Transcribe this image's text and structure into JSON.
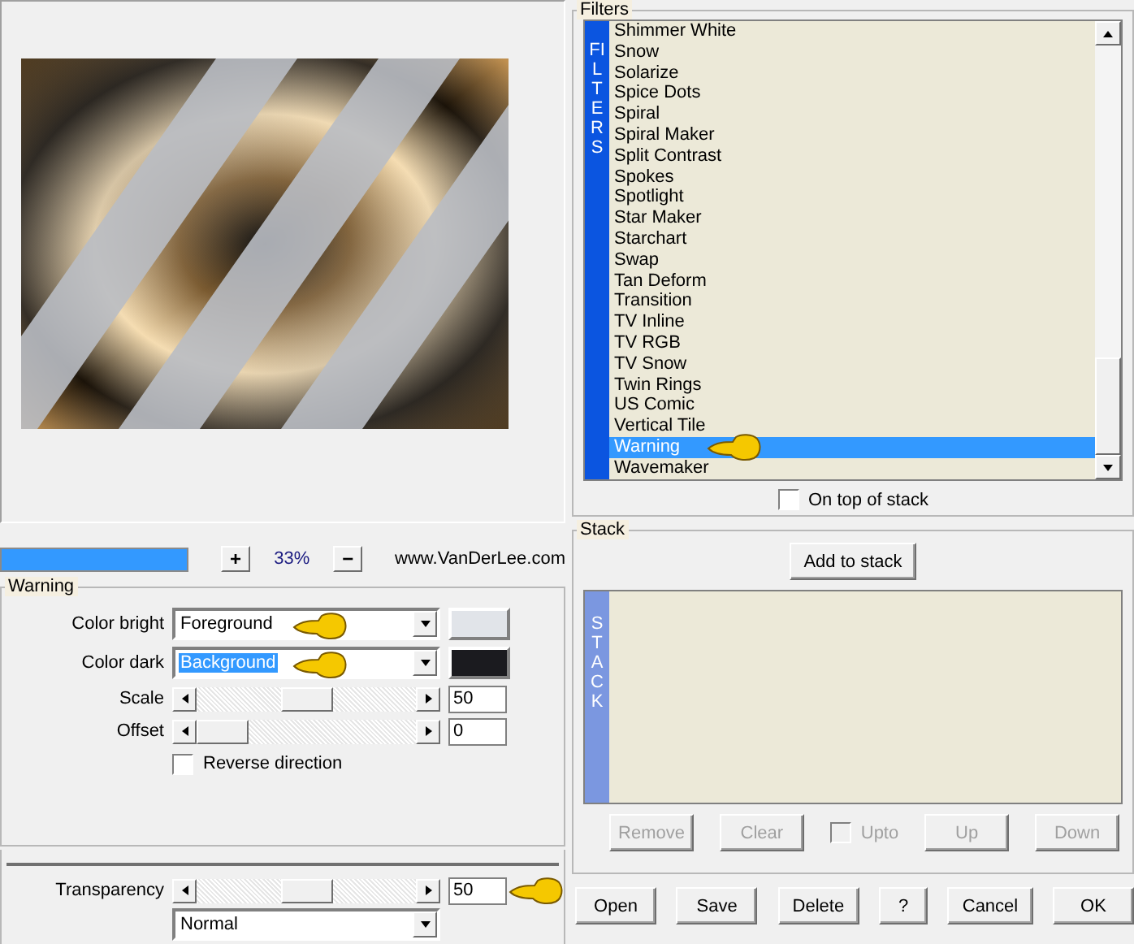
{
  "zoom": {
    "level": 1,
    "plus": "+",
    "value": "33%",
    "minus": "−",
    "link": "www.VanDerLee.com"
  },
  "effect": {
    "title": "Warning",
    "colors": [
      {
        "label": "Color bright",
        "value": "Foreground",
        "selected": false,
        "color": "#e1e4e9"
      },
      {
        "label": "Color dark",
        "value": "Background",
        "selected": true,
        "color": "#1b1b1f"
      }
    ],
    "sliders": [
      {
        "label": "Scale",
        "level": 0.5,
        "value": "50"
      },
      {
        "label": "Offset",
        "level": 0,
        "value": "0"
      }
    ],
    "reverse": {
      "label": "Reverse direction",
      "checked": false
    }
  },
  "transparency": {
    "label": "Transparency",
    "level": 0.5,
    "value": "50",
    "mode": "Normal"
  },
  "filters": {
    "title": "Filters",
    "band": "FILTERS",
    "items": [
      {
        "label": "Shimmer White",
        "selected": false
      },
      {
        "label": "Snow",
        "selected": false
      },
      {
        "label": "Solarize",
        "selected": false
      },
      {
        "label": "Spice Dots",
        "selected": false
      },
      {
        "label": "Spiral",
        "selected": false
      },
      {
        "label": "Spiral Maker",
        "selected": false
      },
      {
        "label": "Split Contrast",
        "selected": false
      },
      {
        "label": "Spokes",
        "selected": false
      },
      {
        "label": "Spotlight",
        "selected": false
      },
      {
        "label": "Star Maker",
        "selected": false
      },
      {
        "label": "Starchart",
        "selected": false
      },
      {
        "label": "Swap",
        "selected": false
      },
      {
        "label": "Tan Deform",
        "selected": false
      },
      {
        "label": "Transition",
        "selected": false
      },
      {
        "label": "TV Inline",
        "selected": false
      },
      {
        "label": "TV RGB",
        "selected": false
      },
      {
        "label": "TV Snow",
        "selected": false
      },
      {
        "label": "Twin Rings",
        "selected": false
      },
      {
        "label": "US Comic",
        "selected": false
      },
      {
        "label": "Vertical Tile",
        "selected": false
      },
      {
        "label": "Warning",
        "selected": true
      },
      {
        "label": "Wavemaker",
        "selected": false
      }
    ],
    "on_top": {
      "label": "On top of stack",
      "checked": false
    }
  },
  "stack": {
    "title": "Stack",
    "band": "STACK",
    "add": "Add to stack",
    "buttons": [
      {
        "kind": "button",
        "label": "Remove",
        "disabled": true
      },
      {
        "kind": "button",
        "label": "Clear",
        "disabled": true
      },
      {
        "kind": "checkbox",
        "label": "Upto",
        "disabled": true,
        "checked": false
      },
      {
        "kind": "button",
        "label": "Up",
        "disabled": true
      },
      {
        "kind": "button",
        "label": "Down",
        "disabled": true
      }
    ]
  },
  "footer": [
    "Open",
    "Save",
    "Delete",
    "?",
    "Cancel",
    "OK"
  ]
}
